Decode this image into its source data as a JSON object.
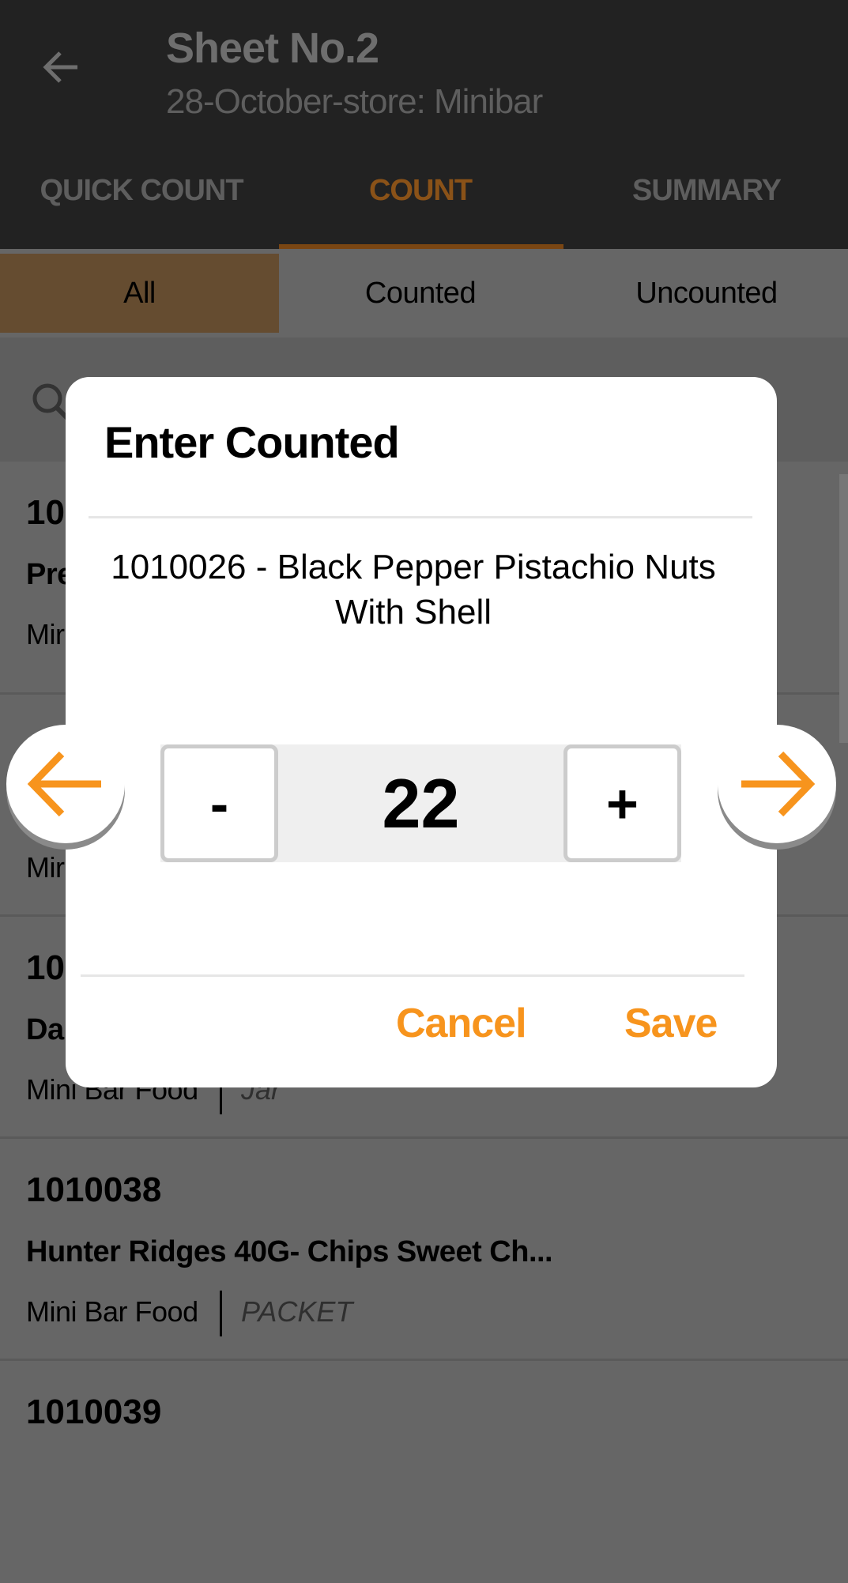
{
  "header": {
    "title": "Sheet No.2",
    "subtitle": "28-October-store: Minibar",
    "back_icon": "arrow-left-icon"
  },
  "tabs": [
    {
      "label": "QUICK COUNT"
    },
    {
      "label": "COUNT",
      "active": true
    },
    {
      "label": "SUMMARY"
    }
  ],
  "filters": [
    {
      "label": "All",
      "active": true
    },
    {
      "label": "Counted"
    },
    {
      "label": "Uncounted"
    }
  ],
  "search": {
    "icon": "search-icon"
  },
  "list": [
    {
      "id": "10",
      "name": "Pre",
      "category": "Mir"
    },
    {
      "id": "",
      "name": "",
      "category": "Mir"
    },
    {
      "id": "10",
      "name": "Da",
      "category": "Mini Bar Food",
      "unit": "Jar"
    },
    {
      "id": "1010038",
      "name": "Hunter Ridges 40G- Chips Sweet Ch...",
      "category": "Mini Bar Food",
      "unit": "PACKET"
    },
    {
      "id": "1010039"
    }
  ],
  "dialog": {
    "title": "Enter Counted",
    "item": "1010026 - Black Pepper Pistachio Nuts With Shell",
    "minus_label": "-",
    "plus_label": "+",
    "value": "22",
    "cancel_label": "Cancel",
    "save_label": "Save"
  },
  "colors": {
    "accent": "#f7941d",
    "header_bg": "#222222"
  }
}
